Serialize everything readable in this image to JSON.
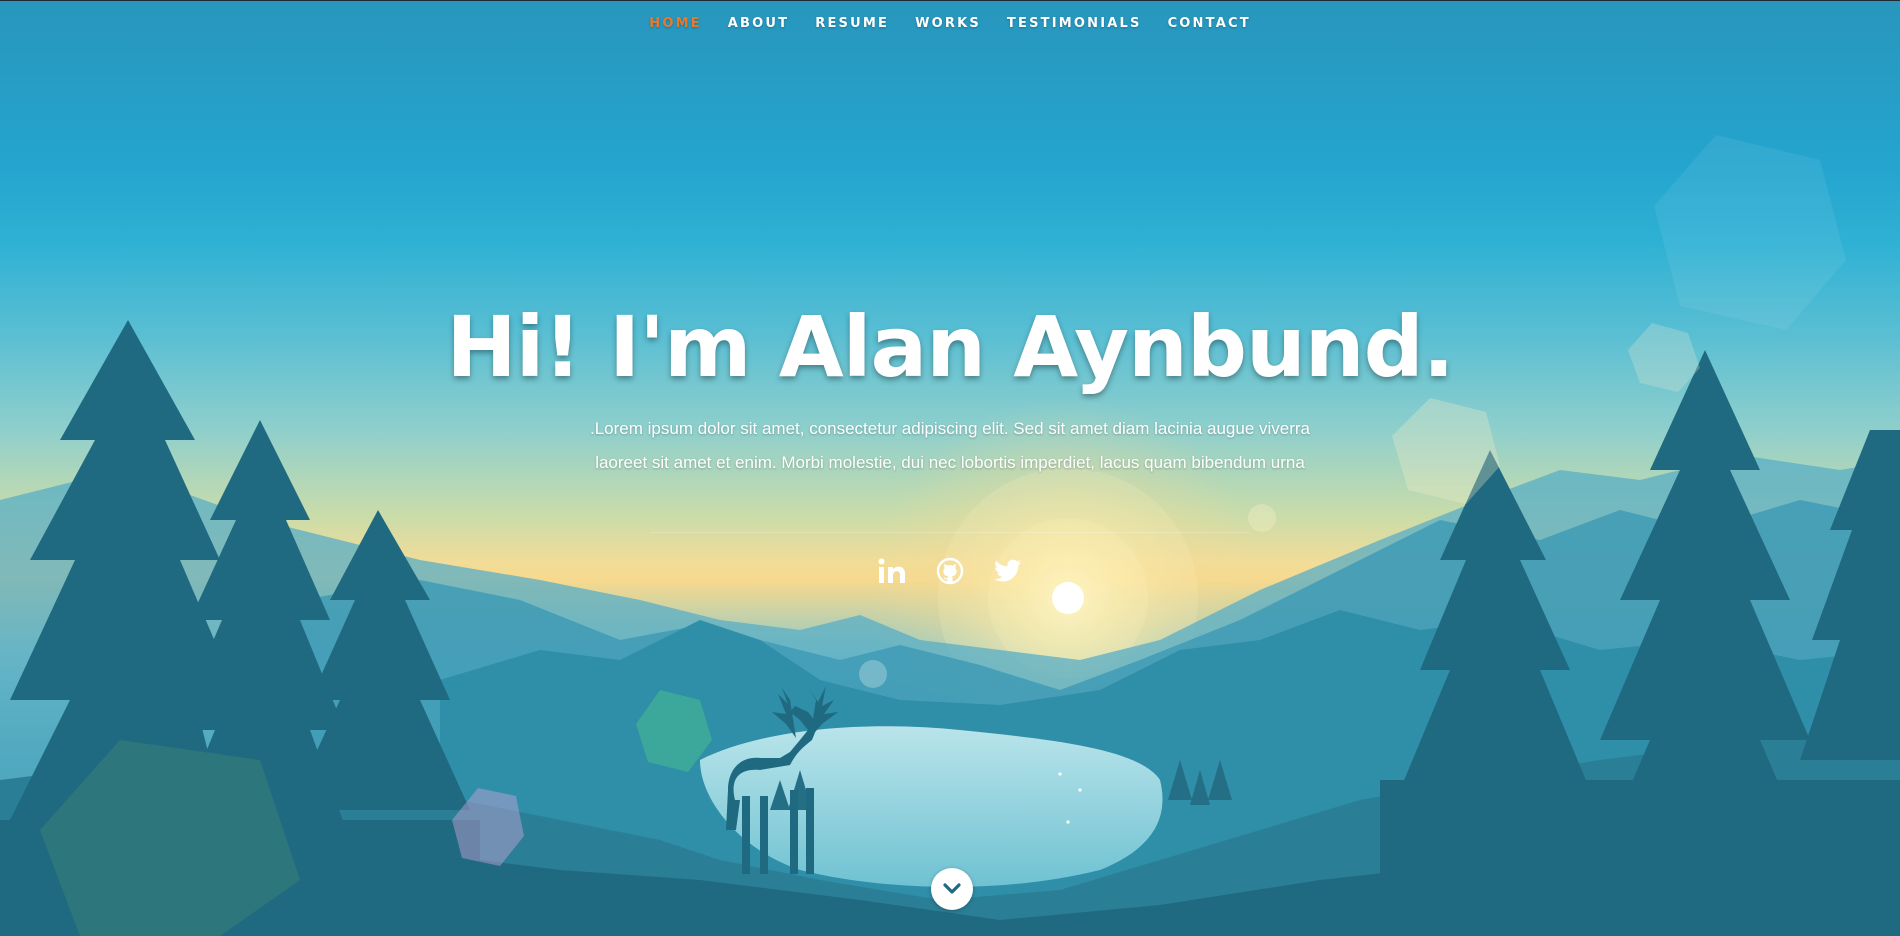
{
  "nav": {
    "items": [
      {
        "label": "HOME",
        "active": true
      },
      {
        "label": "ABOUT",
        "active": false
      },
      {
        "label": "RESUME",
        "active": false
      },
      {
        "label": "WORKS",
        "active": false
      },
      {
        "label": "TESTIMONIALS",
        "active": false
      },
      {
        "label": "CONTACT",
        "active": false
      }
    ],
    "active_color": "#e7792b"
  },
  "hero": {
    "headline": "Hi! I'm Alan Aynbund.",
    "intro": ".Lorem ipsum dolor sit amet, consectetur adipiscing elit. Sed sit amet diam lacinia augue viverra laoreet sit amet et enim. Morbi molestie, dui nec lobortis imperdiet, lacus quam bibendum urna"
  },
  "social": {
    "icons": [
      "linkedin-icon",
      "github-icon",
      "twitter-icon"
    ]
  },
  "scroll": {
    "icon": "chevron-down-icon"
  },
  "colors": {
    "sky_top": "#2896bd",
    "horizon": "#f6d98e",
    "forest": "#1d6d84"
  }
}
